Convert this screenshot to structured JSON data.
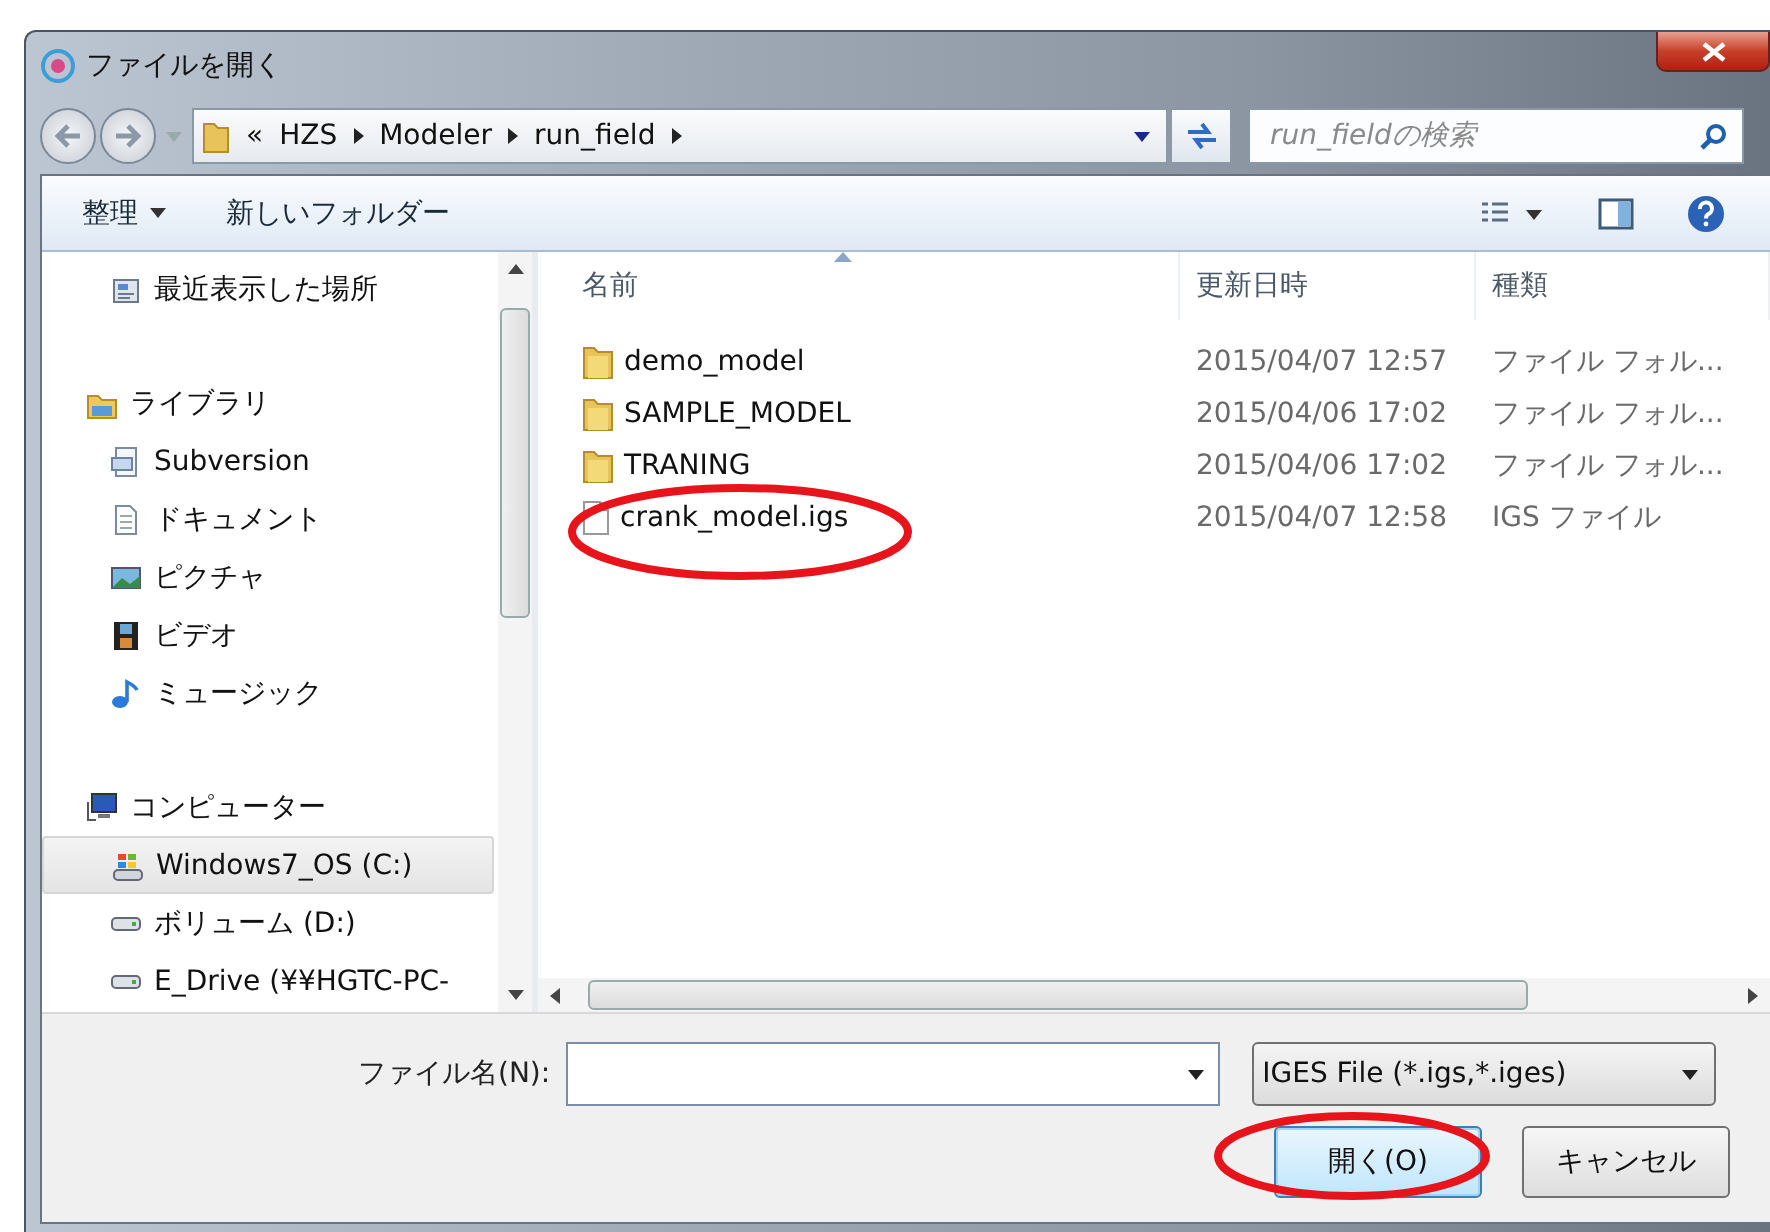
{
  "window": {
    "title": "ファイルを開く"
  },
  "address": {
    "overflow_mark": "«",
    "path": [
      "HZS",
      "Modeler",
      "run_field"
    ]
  },
  "search": {
    "placeholder": "run_fieldの検索"
  },
  "toolbar": {
    "organize": "整理",
    "new_folder": "新しいフォルダー"
  },
  "sidebar": {
    "items": [
      {
        "label": "最近表示した場所",
        "kind": "recent",
        "selected": false
      },
      {
        "label": "ライブラリ",
        "kind": "library",
        "selected": false,
        "children": [
          {
            "label": "Subversion",
            "kind": "svn",
            "selected": false
          },
          {
            "label": "ドキュメント",
            "kind": "document",
            "selected": false
          },
          {
            "label": "ピクチャ",
            "kind": "picture",
            "selected": false
          },
          {
            "label": "ビデオ",
            "kind": "video",
            "selected": false
          },
          {
            "label": "ミュージック",
            "kind": "music",
            "selected": false
          }
        ]
      },
      {
        "label": "コンピューター",
        "kind": "computer",
        "selected": false,
        "children": [
          {
            "label": "Windows7_OS (C:)",
            "kind": "osdrive",
            "selected": true
          },
          {
            "label": "ボリューム (D:)",
            "kind": "drive",
            "selected": false
          },
          {
            "label": "E_Drive (¥¥HGTC-PC-",
            "kind": "drive",
            "selected": false
          }
        ]
      }
    ]
  },
  "table": {
    "columns": [
      "名前",
      "更新日時",
      "種類"
    ],
    "rows": [
      {
        "name": "demo_model",
        "date": "2015/04/07 12:57",
        "type": "ファイル フォル...",
        "kind": "folder"
      },
      {
        "name": "SAMPLE_MODEL",
        "date": "2015/04/06 17:02",
        "type": "ファイル フォル...",
        "kind": "folder"
      },
      {
        "name": "TRANING",
        "date": "2015/04/06 17:02",
        "type": "ファイル フォル...",
        "kind": "folder"
      },
      {
        "name": "crank_model.igs",
        "date": "2015/04/07 12:58",
        "type": "IGS ファイル",
        "kind": "file"
      }
    ]
  },
  "filename": {
    "label": "ファイル名(N):"
  },
  "filter": {
    "value": "IGES File (*.igs,*.iges)"
  },
  "buttons": [
    {
      "label": "開く(O)",
      "kind": "primary"
    },
    {
      "label": "キャンセル",
      "kind": "normal"
    }
  ]
}
